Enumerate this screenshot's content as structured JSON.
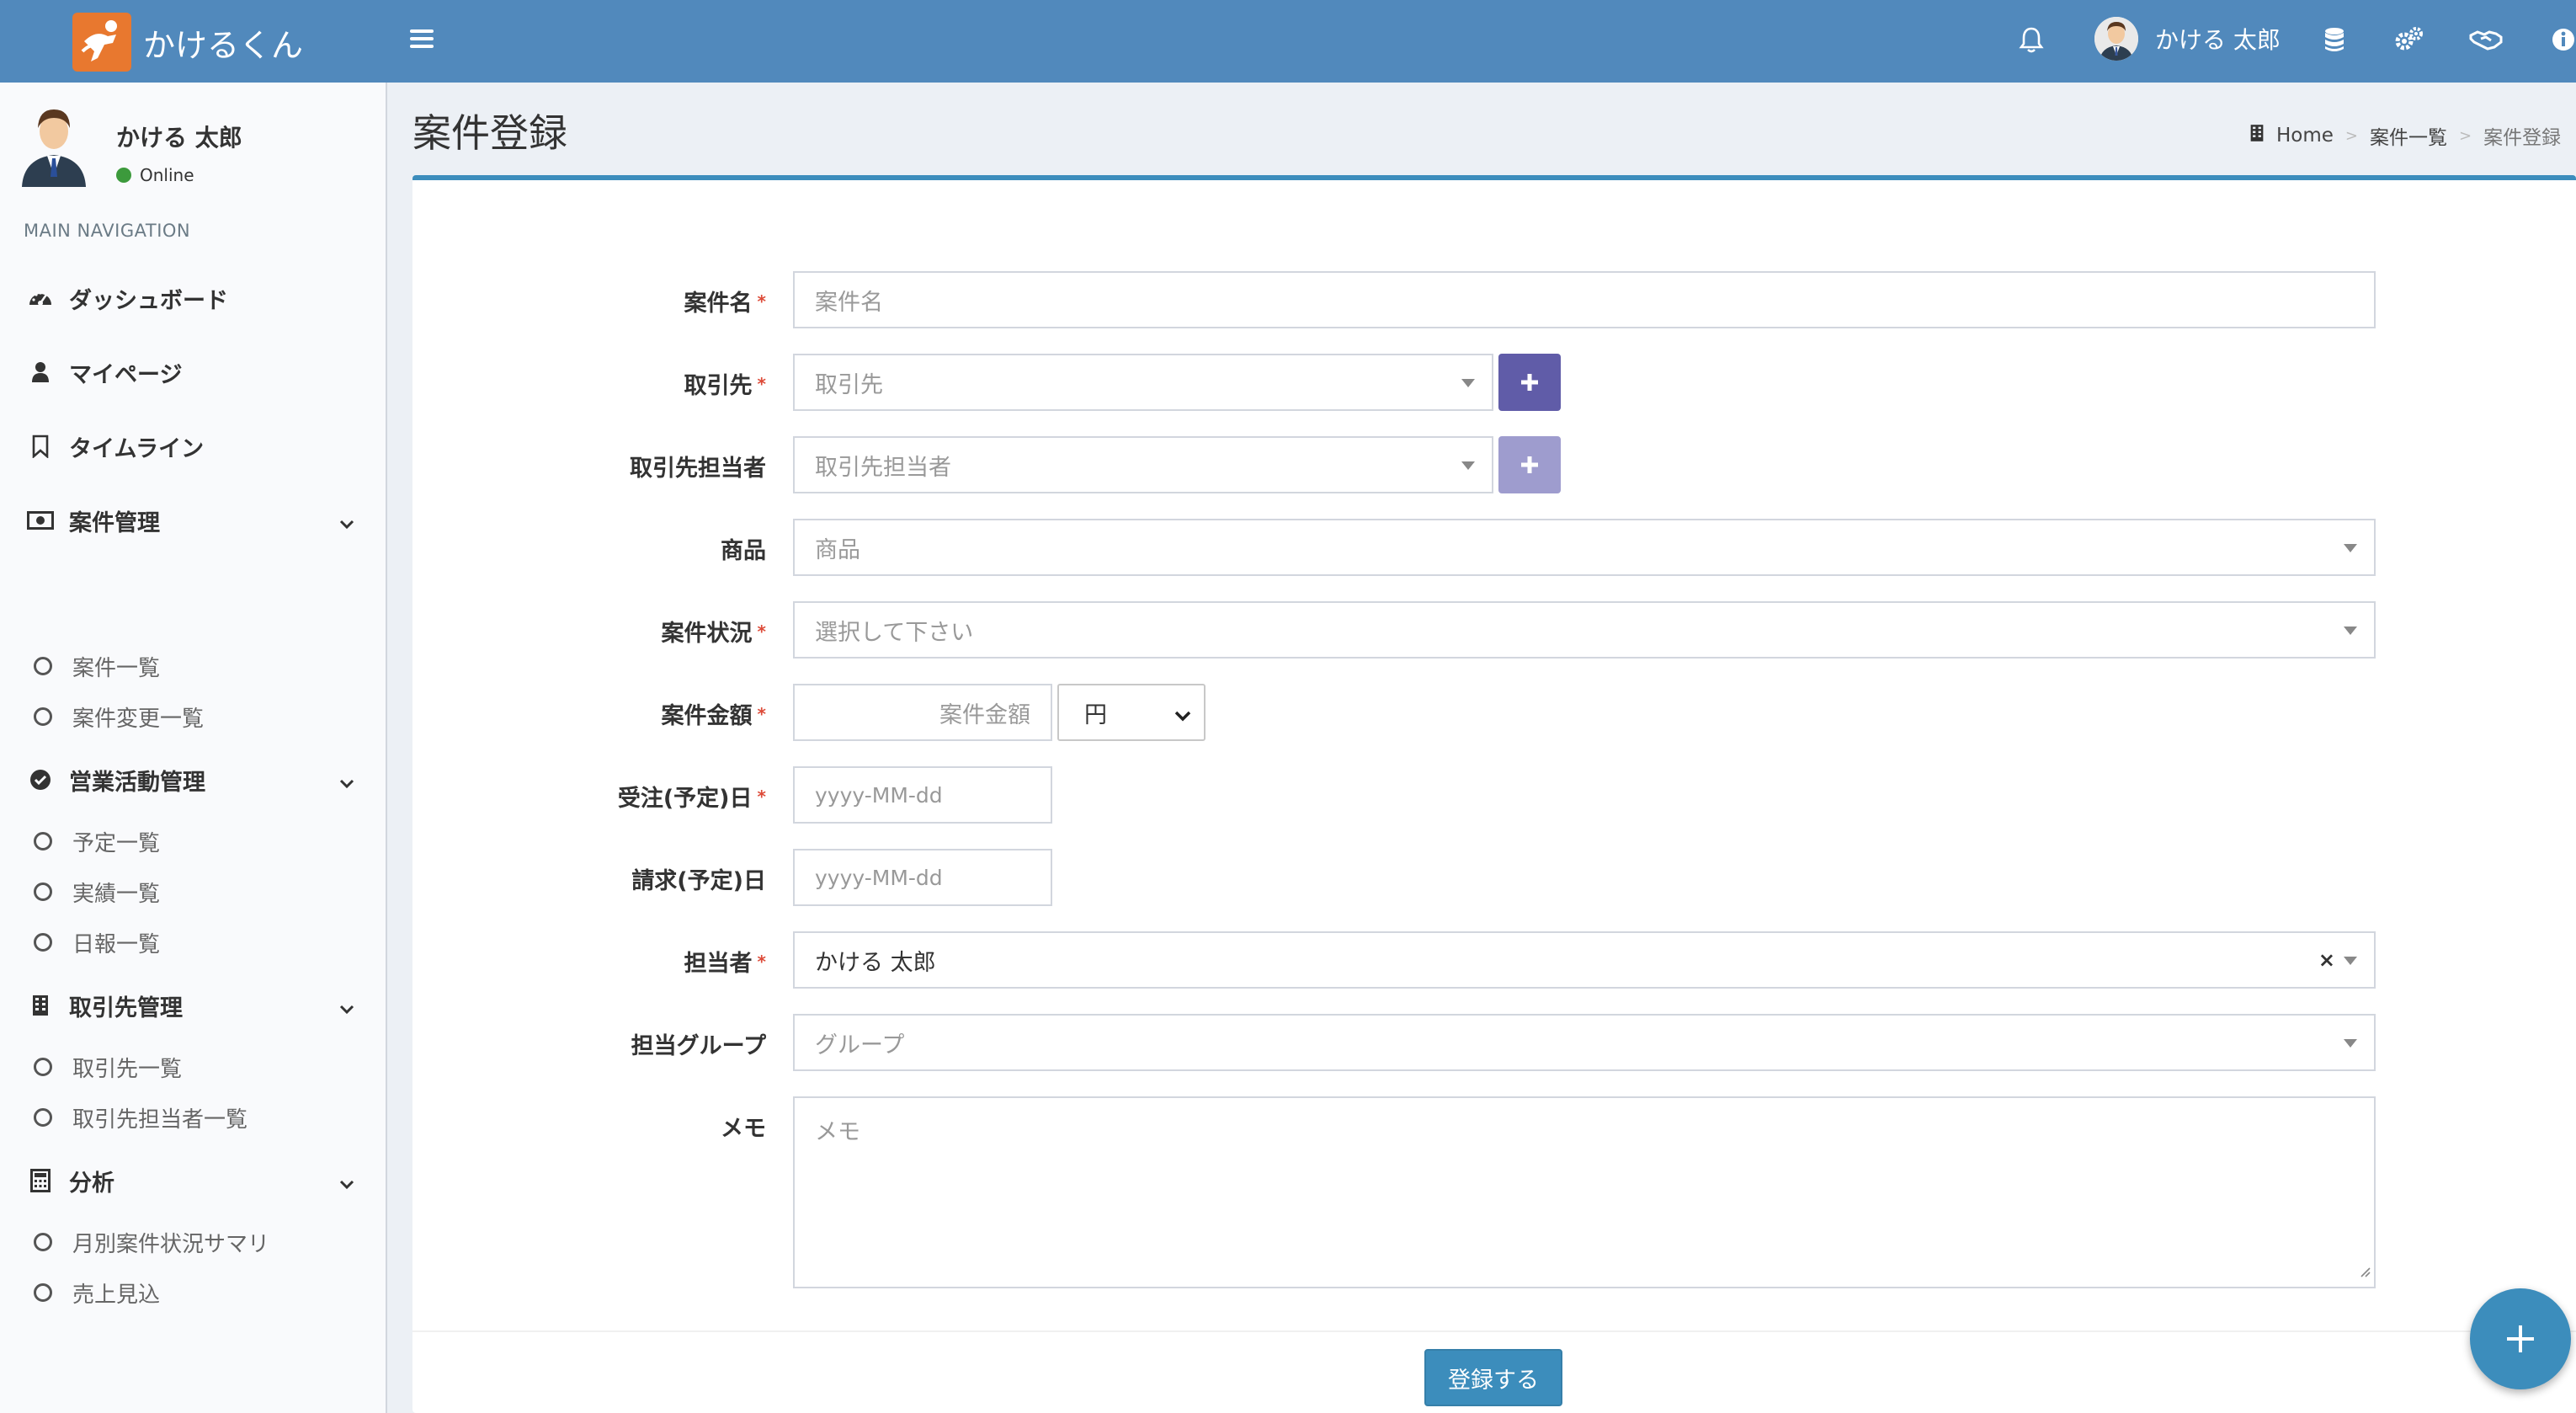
{
  "app": {
    "title": "かけるくん",
    "brand_color": "#5189bc",
    "logo_color": "#e8782f"
  },
  "header": {
    "user_name": "かける 太郎",
    "icons": [
      "bell-icon",
      "database-icon",
      "gears-icon",
      "handshake-icon",
      "info-icon"
    ]
  },
  "sidebar": {
    "user_name": "かける 太郎",
    "status": "Online",
    "nav_header": "MAIN NAVIGATION",
    "items": {
      "dashboard": "ダッシュボード",
      "mypage": "マイページ",
      "timeline": "タイムライン",
      "deal_mgmt": "案件管理",
      "deal_list": "案件一覧",
      "deal_change_list": "案件変更一覧",
      "sales_mgmt": "営業活動管理",
      "schedule_list": "予定一覧",
      "result_list": "実績一覧",
      "daily_list": "日報一覧",
      "client_mgmt": "取引先管理",
      "client_list": "取引先一覧",
      "client_contact_list": "取引先担当者一覧",
      "analysis": "分析",
      "monthly_summary": "月別案件状況サマリ",
      "sales_forecast": "売上見込"
    }
  },
  "page": {
    "title": "案件登録",
    "breadcrumb": {
      "home": "Home",
      "parent": "案件一覧",
      "current": "案件登録"
    }
  },
  "form": {
    "required_mark": "*",
    "deal_name": {
      "label": "案件名",
      "placeholder": "案件名"
    },
    "client": {
      "label": "取引先",
      "placeholder": "取引先"
    },
    "client_contact": {
      "label": "取引先担当者",
      "placeholder": "取引先担当者"
    },
    "product": {
      "label": "商品",
      "placeholder": "商品"
    },
    "status": {
      "label": "案件状況",
      "placeholder": "選択して下さい"
    },
    "amount": {
      "label": "案件金額",
      "placeholder": "案件金額",
      "currency": "円"
    },
    "order_date": {
      "label": "受注(予定)日",
      "placeholder": "yyyy-MM-dd"
    },
    "bill_date": {
      "label": "請求(予定)日",
      "placeholder": "yyyy-MM-dd"
    },
    "assignee": {
      "label": "担当者",
      "value": "かける 太郎",
      "clear": "×"
    },
    "group": {
      "label": "担当グループ",
      "placeholder": "グループ"
    },
    "memo": {
      "label": "メモ",
      "placeholder": "メモ"
    },
    "submit": "登録する"
  }
}
